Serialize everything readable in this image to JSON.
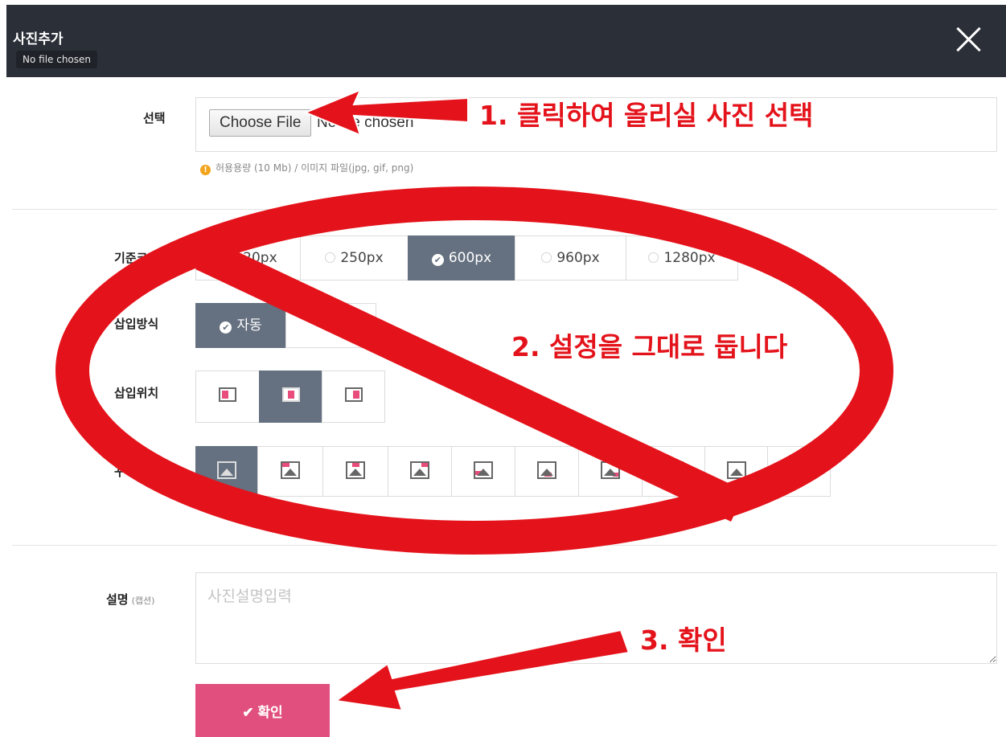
{
  "header": {
    "title": "사진추가",
    "tooltip": "No file chosen"
  },
  "file_select": {
    "label": "선택",
    "button_label": "Choose File",
    "status": "No file chosen",
    "hint": "허용용량 (10 Mb) / 이미지 파일(jpg, gif, png)",
    "hint_icon": "!"
  },
  "size": {
    "label": "기준크기",
    "options": [
      {
        "label": "120px",
        "selected": false
      },
      {
        "label": "250px",
        "selected": false
      },
      {
        "label": "600px",
        "selected": true
      },
      {
        "label": "960px",
        "selected": false
      },
      {
        "label": "1280px",
        "selected": false
      }
    ]
  },
  "insert_method": {
    "label": "삽입방식",
    "selected_label": "자동",
    "check_icon": "✔"
  },
  "insert_position": {
    "label": "삽입위치",
    "options": [
      "left-align-icon",
      "center-align-icon",
      "right-align-icon"
    ],
    "selected_index": 1
  },
  "frame_style": {
    "label": "꾸미기",
    "selected_index": 0,
    "count": 10
  },
  "caption": {
    "label": "설명",
    "sublabel": "(캡션)",
    "placeholder": "사진설명입력"
  },
  "confirm": {
    "label": "✔ 확인"
  },
  "annotations": {
    "step1": "1. 클릭하여 올리실 사진 선택",
    "step2": "2. 설정을 그대로 둡니다",
    "step3": "3. 확인"
  },
  "colors": {
    "header_bg": "#2b2f37",
    "selected_bg": "#657080",
    "confirm_bg": "#e14f7e",
    "annotation_red": "#e4131b",
    "accent_pink": "#e84c7a"
  }
}
